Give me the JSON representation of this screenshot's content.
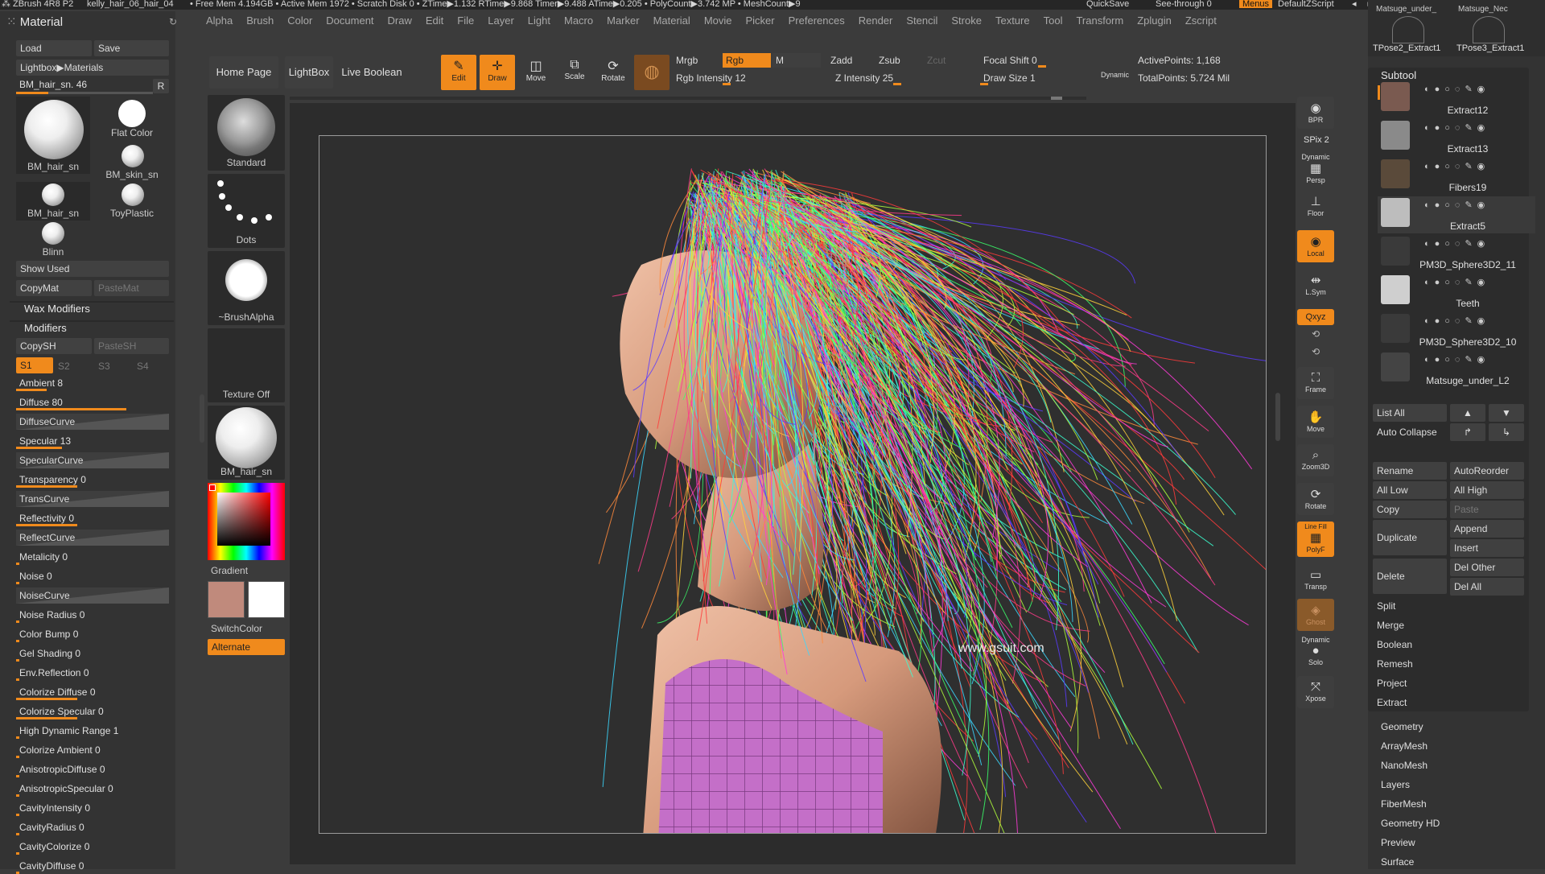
{
  "titlebar": {
    "app": "ZBrush 4R8 P2",
    "document": "kelly_hair_06_hair_04",
    "stats": "• Free Mem 4.194GB • Active Mem 1972 • Scratch Disk 0 • ZTime▶1.132 RTime▶9.868 Timer▶9.488 ATime▶0.205 • PolyCount▶3.742 MP • MeshCount▶9",
    "quicksave": "QuickSave",
    "see_through": "See-through  0",
    "menus": "Menus",
    "default_script": "DefaultZScript"
  },
  "menubar": [
    "Alpha",
    "Brush",
    "Color",
    "Document",
    "Draw",
    "Edit",
    "File",
    "Layer",
    "Light",
    "Macro",
    "Marker",
    "Material",
    "Movie",
    "Picker",
    "Preferences",
    "Render",
    "Stencil",
    "Stroke",
    "Texture",
    "Tool",
    "Transform",
    "Zplugin",
    "Zscript"
  ],
  "material_panel": {
    "title": "Material",
    "load": "Load",
    "save": "Save",
    "lightbox_materials": "Lightbox▶Materials",
    "current_material": "BM_hair_sn. 46",
    "r_button": "R",
    "swatches": [
      "BM_hair_sn",
      "Flat Color",
      "BM_skin_sn",
      "BM_hair_sn",
      "ToyPlastic",
      "Blinn"
    ],
    "show_used": "Show Used",
    "copymat": "CopyMat",
    "pastemat": "PasteMat",
    "wax_modifiers": "Wax Modifiers",
    "modifiers": "Modifiers",
    "copysh": "CopySH",
    "pastesh": "PasteSH",
    "shaders": [
      "S1",
      "S2",
      "S3",
      "S4"
    ]
  },
  "modifiers": [
    {
      "label": "Ambient 8",
      "kind": "slider",
      "value": 0.2
    },
    {
      "label": "Diffuse 80",
      "kind": "slider",
      "value": 0.72
    },
    {
      "label": "DiffuseCurve",
      "kind": "curve"
    },
    {
      "label": "Specular 13",
      "kind": "slider",
      "value": 0.3
    },
    {
      "label": "SpecularCurve",
      "kind": "curve"
    },
    {
      "label": "Transparency 0",
      "kind": "slider",
      "value": 0.4
    },
    {
      "label": "TransCurve",
      "kind": "curve"
    },
    {
      "label": "Reflectivity 0",
      "kind": "slider",
      "value": 0.4
    },
    {
      "label": "ReflectCurve",
      "kind": "curve"
    },
    {
      "label": "Metalicity 0",
      "kind": "slider",
      "value": 0
    },
    {
      "label": "Noise 0",
      "kind": "slider",
      "value": 0
    },
    {
      "label": "NoiseCurve",
      "kind": "curve"
    },
    {
      "label": "Noise Radius 0",
      "kind": "slider",
      "value": 0
    },
    {
      "label": "Color Bump 0",
      "kind": "slider",
      "value": 0
    },
    {
      "label": "Gel Shading 0",
      "kind": "slider",
      "value": 0
    },
    {
      "label": "Env.Reflection 0",
      "kind": "slider",
      "value": 0
    },
    {
      "label": "Colorize Diffuse 0",
      "kind": "slider",
      "value": 0.4
    },
    {
      "label": "Colorize Specular 0",
      "kind": "slider",
      "value": 0.4
    },
    {
      "label": "High Dynamic Range 1",
      "kind": "slider",
      "value": 0
    },
    {
      "label": "Colorize Ambient 0",
      "kind": "slider",
      "value": 0
    },
    {
      "label": "AnisotropicDiffuse 0",
      "kind": "slider",
      "value": 0
    },
    {
      "label": "AnisotropicSpecular 0",
      "kind": "slider",
      "value": 0
    },
    {
      "label": "CavityIntensity 0",
      "kind": "slider",
      "value": 0
    },
    {
      "label": "CavityRadius 0",
      "kind": "slider",
      "value": 0
    },
    {
      "label": "CavityColorize 0",
      "kind": "slider",
      "value": 0
    },
    {
      "label": "CavityDiffuse 0",
      "kind": "slider",
      "value": 0
    }
  ],
  "brush_column": {
    "standard": "Standard",
    "dots": "Dots",
    "brush_alpha": "~BrushAlpha",
    "texture_off": "Texture Off",
    "material": "BM_hair_sn",
    "gradient": "Gradient",
    "switch_color": "SwitchColor",
    "alternate": "Alternate",
    "main_color": "#c08a7c",
    "secondary_color": "#ffffff"
  },
  "toolbar": {
    "home_page": "Home Page",
    "lightbox": "LightBox",
    "live_boolean": "Live Boolean",
    "edit": "Edit",
    "draw": "Draw",
    "move": "Move",
    "scale": "Scale",
    "rotate": "Rotate",
    "mrgb": "Mrgb",
    "rgb": "Rgb",
    "m": "M",
    "rgb_intensity": "Rgb Intensity 12",
    "zadd": "Zadd",
    "zsub": "Zsub",
    "zcut": "Zcut",
    "z_intensity": "Z Intensity 25",
    "focal_shift": "Focal Shift 0",
    "draw_size": "Draw Size 1",
    "dynamic": "Dynamic",
    "active_points": "ActivePoints: 1,168",
    "total_points": "TotalPoints: 5.724 Mil"
  },
  "canvas": {
    "watermark": "www.gsuit.com"
  },
  "right_strip": {
    "bpr": "BPR",
    "spix": "SPix 2",
    "dynamic": "Dynamic",
    "persp": "Persp",
    "floor": "Floor",
    "local": "Local",
    "lsym": "L.Sym",
    "xyz": "Qxyz",
    "frame": "Frame",
    "move": "Move",
    "zoom3d": "Zoom3D",
    "rotate": "Rotate",
    "linefill": "Line Fill",
    "polyf": "PolyF",
    "transp": "Transp",
    "ghost": "Ghost",
    "dynamic2": "Dynamic",
    "solo": "Solo",
    "xpose": "Xpose"
  },
  "tool_thumbs": [
    "Matsuge_under_",
    "Matsuge_Nec",
    "TPose2_Extract1",
    "TPose3_Extract1"
  ],
  "subtool": {
    "title": "Subtool",
    "items": [
      "Extract12",
      "Extract13",
      "Fibers19",
      "Extract5",
      "PM3D_Sphere3D2_11",
      "Teeth",
      "PM3D_Sphere3D2_10",
      "Matsuge_under_L2"
    ],
    "list_all": "List All",
    "auto_collapse": "Auto Collapse",
    "rename": "Rename",
    "auto_reorder": "AutoReorder",
    "all_low": "All Low",
    "all_high": "All High",
    "copy": "Copy",
    "paste": "Paste",
    "duplicate": "Duplicate",
    "append": "Append",
    "insert": "Insert",
    "delete": "Delete",
    "del_other": "Del Other",
    "del_all": "Del All",
    "split": "Split",
    "merge": "Merge",
    "boolean": "Boolean",
    "remesh": "Remesh",
    "project": "Project",
    "extract": "Extract"
  },
  "tool_sections": [
    "Geometry",
    "ArrayMesh",
    "NanoMesh",
    "Layers",
    "FiberMesh",
    "Geometry HD",
    "Preview",
    "Surface"
  ]
}
